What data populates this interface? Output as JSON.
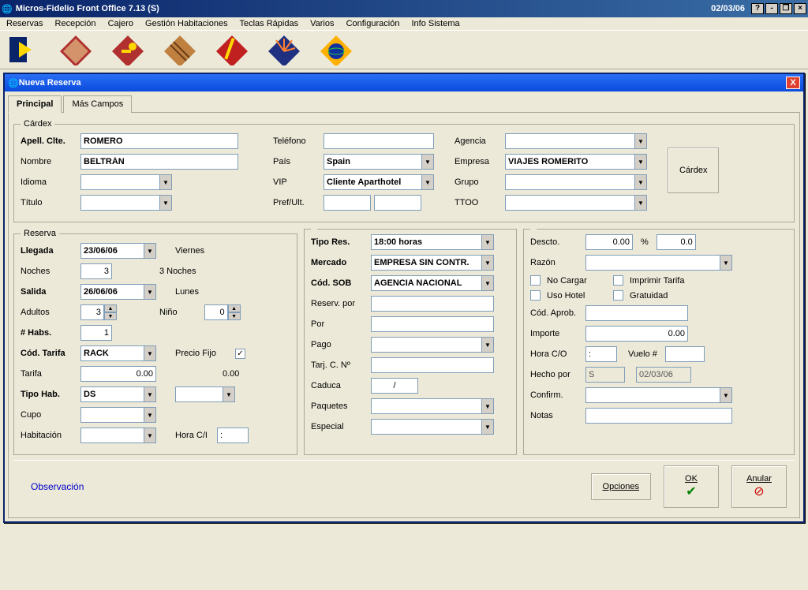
{
  "app": {
    "title": "Micros-Fidelio Front Office 7.13 (S)",
    "date": "02/03/06"
  },
  "menu": [
    "Reservas",
    "Recepción",
    "Cajero",
    "Gestión Habitaciones",
    "Teclas Rápidas",
    "Varios",
    "Configuración",
    "Info Sistema"
  ],
  "dialog": {
    "title": "Nueva Reserva"
  },
  "tabs": {
    "principal": "Principal",
    "mas": "Más Campos"
  },
  "cardex": {
    "legend": "Cárdex",
    "apell_lbl": "Apell. Clte.",
    "apell": "ROMERO",
    "nombre_lbl": "Nombre",
    "nombre": "BELTRÁN",
    "idioma_lbl": "Idioma",
    "idioma": "",
    "titulo_lbl": "Título",
    "titulo": "",
    "telefono_lbl": "Teléfono",
    "telefono": "",
    "pais_lbl": "País",
    "pais": "Spain",
    "vip_lbl": "VIP",
    "vip": "Cliente Aparthotel",
    "pref_lbl": "Pref/Ult.",
    "pref1": "",
    "pref2": "",
    "agencia_lbl": "Agencia",
    "agencia": "",
    "empresa_lbl": "Empresa",
    "empresa": "VIAJES ROMERITO",
    "grupo_lbl": "Grupo",
    "grupo": "",
    "ttoo_lbl": "TTOO",
    "ttoo": "",
    "cardex_btn": "Cárdex"
  },
  "reserva": {
    "legend": "Reserva",
    "llegada_lbl": "Llegada",
    "llegada": "23/06/06",
    "llegada_day": "Viernes",
    "noches_lbl": "Noches",
    "noches": "3",
    "noches_txt": "3 Noches",
    "salida_lbl": "Salida",
    "salida": "26/06/06",
    "salida_day": "Lunes",
    "adultos_lbl": "Adultos",
    "adultos": "3",
    "nino_lbl": "Niño",
    "nino": "0",
    "habs_lbl": "# Habs.",
    "habs": "1",
    "codtarifa_lbl": "Cód. Tarifa",
    "codtarifa": "RACK",
    "preciofijo_lbl": "Precio Fijo",
    "preciofijo": true,
    "tarifa_lbl": "Tarifa",
    "tarifa": "0.00",
    "tarifa2": "0.00",
    "tipohab_lbl": "Tipo Hab.",
    "tipohab": "DS",
    "tipohab2": "",
    "cupo_lbl": "Cupo",
    "cupo": "",
    "habitacion_lbl": "Habitación",
    "habitacion": "",
    "horaci_lbl": "Hora C/I",
    "horaci": ":"
  },
  "mid": {
    "tipores_lbl": "Tipo Res.",
    "tipores": "18:00 horas",
    "mercado_lbl": "Mercado",
    "mercado": "EMPRESA SIN CONTR.",
    "codsob_lbl": "Cód. SOB",
    "codsob": "AGENCIA NACIONAL",
    "reservpor_lbl": "Reserv. por",
    "reservpor": "",
    "por_lbl": "Por",
    "por": "",
    "pago_lbl": "Pago",
    "pago": "",
    "tarjc_lbl": "Tarj. C. Nº",
    "tarjc": "",
    "caduca_lbl": "Caduca",
    "caduca": "/",
    "paquetes_lbl": "Paquetes",
    "paquetes": "",
    "especial_lbl": "Especial",
    "especial": ""
  },
  "right": {
    "descto_lbl": "Descto.",
    "descto": "0.00",
    "pct": "%",
    "desctopct": "0.0",
    "razon_lbl": "Razón",
    "razon": "",
    "nocargar_lbl": "No Cargar",
    "imprimir_lbl": "Imprimir Tarifa",
    "usohotel_lbl": "Uso Hotel",
    "gratuidad_lbl": "Gratuidad",
    "codaprob_lbl": "Cód. Aprob.",
    "codaprob": "",
    "importe_lbl": "Importe",
    "importe": "0.00",
    "horaco_lbl": "Hora C/O",
    "horaco": ":",
    "vuelo_lbl": "Vuelo #",
    "vuelo": "",
    "hechopor_lbl": "Hecho por",
    "hechopor": "S",
    "hechopor_date": "02/03/06",
    "confirm_lbl": "Confirm.",
    "confirm": "",
    "notas_lbl": "Notas",
    "notas": ""
  },
  "footer": {
    "observacion": "Observación",
    "opciones": "Opciones",
    "ok": "OK",
    "anular": "Anular"
  }
}
